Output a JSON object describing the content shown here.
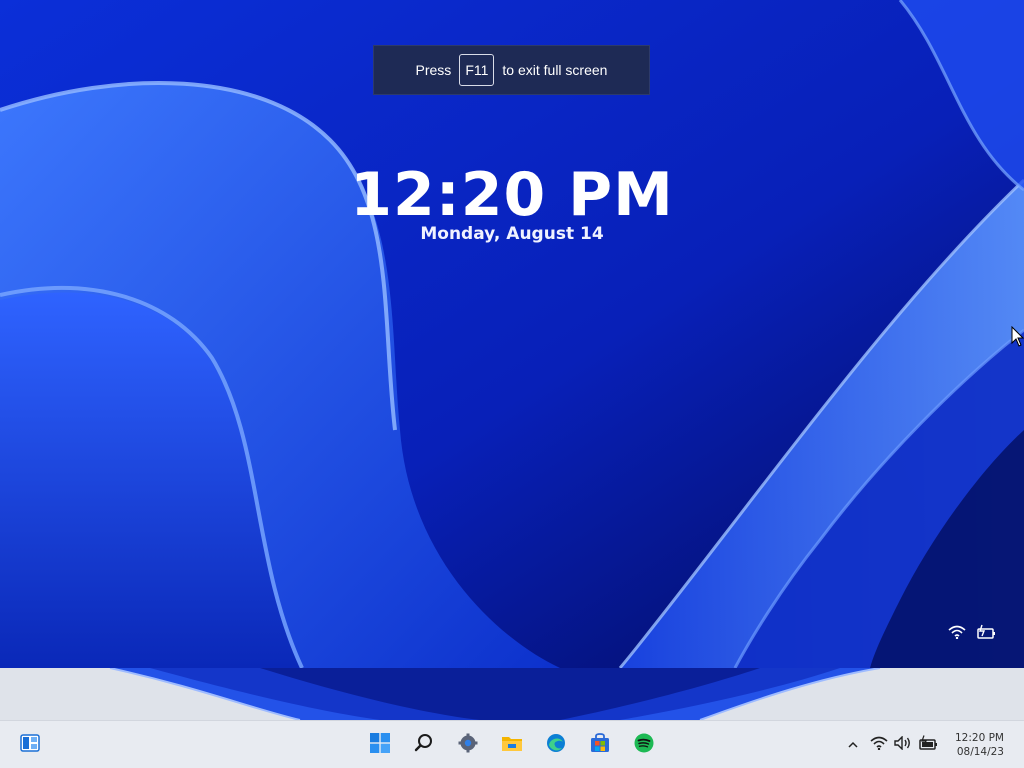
{
  "fullscreen_notice": {
    "prefix": "Press",
    "key": "F11",
    "suffix": "to exit full screen"
  },
  "lock_screen": {
    "time": "12:20 PM",
    "date": "Monday, August 14",
    "status_icons": [
      "wifi-icon",
      "battery-charging-icon"
    ]
  },
  "taskbar": {
    "left_icons": [
      "widgets-icon"
    ],
    "center_icons": [
      "windows-start-icon",
      "search-icon",
      "settings-icon",
      "file-explorer-icon",
      "edge-icon",
      "store-icon",
      "spotify-icon"
    ],
    "tray_icons": [
      "chevron-up-icon",
      "wifi-icon",
      "volume-icon",
      "battery-charging-icon"
    ],
    "clock_time": "12:20 PM",
    "clock_date": "08/14/23"
  },
  "colors": {
    "wallpaper_base": "#0a1ea8",
    "ribbon_light": "#4e86ff",
    "taskbar_bg": "#e8ebf1",
    "toast_bg": "#1e2a55",
    "spotify": "#1db954",
    "start_blue": "#1a7ce0"
  }
}
